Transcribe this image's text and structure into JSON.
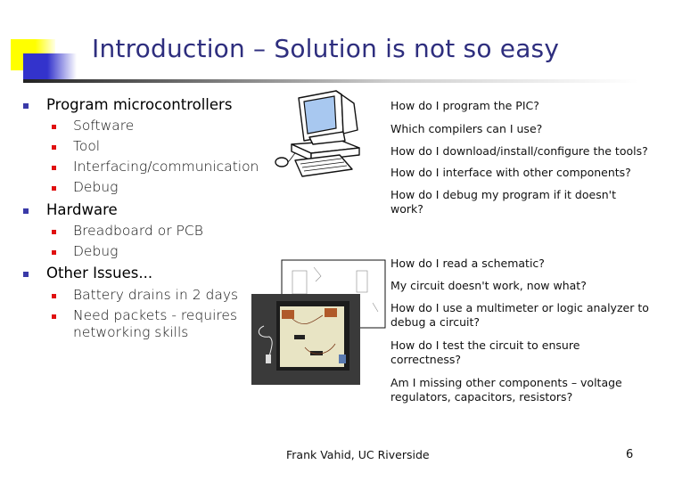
{
  "slide": {
    "title": "Introduction – Solution is not so easy",
    "bullets": [
      {
        "label": "Program microcontrollers",
        "children": [
          "Software",
          "Tool",
          "Interfacing/communication",
          "Debug"
        ]
      },
      {
        "label": "Hardware",
        "children": [
          "Breadboard or PCB",
          "Debug"
        ]
      },
      {
        "label": "Other Issues...",
        "children": [
          "Battery drains in 2 days",
          "Need packets - requires",
          "networking skills"
        ]
      }
    ],
    "questions": [
      {
        "line1": "How do I program the PIC?"
      },
      {
        "line1": "Which compilers can I use?"
      },
      {
        "line1": "How do I download/install/configure the tools?"
      },
      {
        "line1": "How do I interface with other components?"
      },
      {
        "line1": "How do I debug my program if it doesn't",
        "line2": "work?"
      },
      {
        "line1": "How do I read a schematic?"
      },
      {
        "line1": "My circuit doesn't work, now what?"
      },
      {
        "line1": "How do I use a multimeter or logic analyzer to",
        "line2": "debug a circuit?"
      },
      {
        "line1": "How do I test the circuit to ensure",
        "line2": "correctness?"
      },
      {
        "line1": "Am I missing other components – voltage",
        "line2": "regulators, capacitors, resistors?"
      }
    ],
    "images": {
      "computer": "computer-clipart-icon",
      "breadboard": "breadboard-photo"
    },
    "footer": {
      "author": "Frank Vahid, UC Riverside",
      "page": "6"
    },
    "colors": {
      "title": "#2e2e7e",
      "bullet_level1": "#3a3aa8",
      "bullet_level2": "#e01010",
      "accent_yellow": "#ffff00",
      "accent_blue": "#3333cc"
    }
  }
}
